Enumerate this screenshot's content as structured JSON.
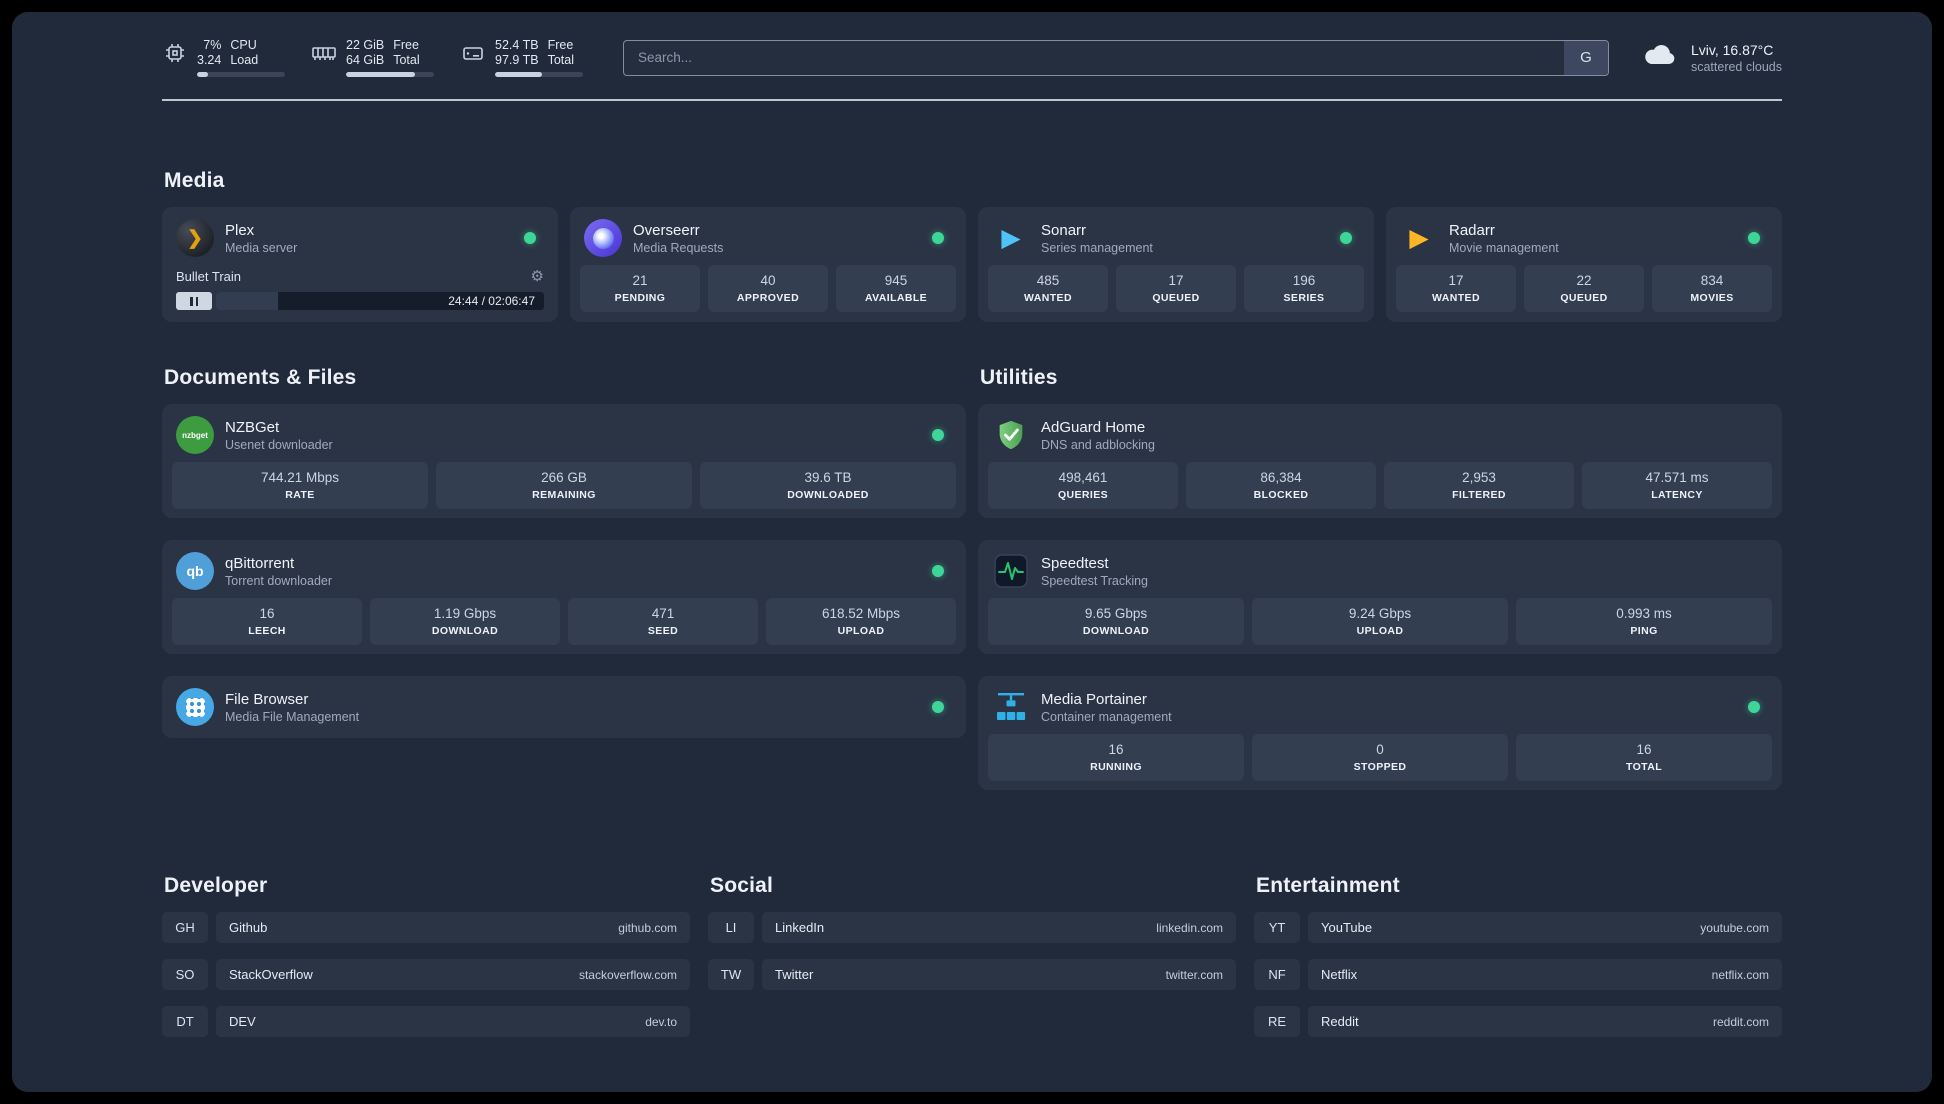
{
  "topbar": {
    "cpu": {
      "value1": "7%",
      "value2": "3.24",
      "label1": "CPU",
      "label2": "Load",
      "progress_pct": 12
    },
    "ram": {
      "value1": "22 GiB",
      "value2": "64 GiB",
      "label1": "Free",
      "label2": "Total",
      "progress_pct": 78
    },
    "disk": {
      "value1": "52.4 TB",
      "value2": "97.9 TB",
      "label1": "Free",
      "label2": "Total",
      "progress_pct": 53
    },
    "search": {
      "placeholder": "Search...",
      "provider": "G"
    },
    "weather": {
      "location": "Lviv, 16.87°C",
      "condition": "scattered clouds"
    }
  },
  "sections": {
    "media": {
      "title": "Media"
    },
    "documents": {
      "title": "Documents & Files"
    },
    "utilities": {
      "title": "Utilities"
    },
    "developer": {
      "title": "Developer"
    },
    "social": {
      "title": "Social"
    },
    "entertainment": {
      "title": "Entertainment"
    }
  },
  "icons": {
    "plex": "❯",
    "sonarr": "▶",
    "radarr": "▶",
    "gear": "⚙",
    "nzbget_text": "nzbget",
    "qb_text": "qb"
  },
  "services": {
    "plex": {
      "name": "Plex",
      "desc": "Media server",
      "player": {
        "title": "Bullet Train",
        "time": "24:44 / 02:06:47",
        "progress_pct": 19
      }
    },
    "overseerr": {
      "name": "Overseerr",
      "desc": "Media Requests",
      "stats": [
        {
          "value": "21",
          "label": "PENDING"
        },
        {
          "value": "40",
          "label": "APPROVED"
        },
        {
          "value": "945",
          "label": "AVAILABLE"
        }
      ]
    },
    "sonarr": {
      "name": "Sonarr",
      "desc": "Series management",
      "stats": [
        {
          "value": "485",
          "label": "WANTED"
        },
        {
          "value": "17",
          "label": "QUEUED"
        },
        {
          "value": "196",
          "label": "SERIES"
        }
      ]
    },
    "radarr": {
      "name": "Radarr",
      "desc": "Movie management",
      "stats": [
        {
          "value": "17",
          "label": "WANTED"
        },
        {
          "value": "22",
          "label": "QUEUED"
        },
        {
          "value": "834",
          "label": "MOVIES"
        }
      ]
    },
    "nzbget": {
      "name": "NZBGet",
      "desc": "Usenet downloader",
      "stats": [
        {
          "value": "744.21 Mbps",
          "label": "RATE"
        },
        {
          "value": "266 GB",
          "label": "REMAINING"
        },
        {
          "value": "39.6 TB",
          "label": "DOWNLOADED"
        }
      ]
    },
    "qbittorrent": {
      "name": "qBittorrent",
      "desc": "Torrent downloader",
      "stats": [
        {
          "value": "16",
          "label": "LEECH"
        },
        {
          "value": "1.19 Gbps",
          "label": "DOWNLOAD"
        },
        {
          "value": "471",
          "label": "SEED"
        },
        {
          "value": "618.52 Mbps",
          "label": "UPLOAD"
        }
      ]
    },
    "filebrowser": {
      "name": "File Browser",
      "desc": "Media File Management"
    },
    "adguard": {
      "name": "AdGuard Home",
      "desc": "DNS and adblocking",
      "stats": [
        {
          "value": "498,461",
          "label": "QUERIES"
        },
        {
          "value": "86,384",
          "label": "BLOCKED"
        },
        {
          "value": "2,953",
          "label": "FILTERED"
        },
        {
          "value": "47.571 ms",
          "label": "LATENCY"
        }
      ]
    },
    "speedtest": {
      "name": "Speedtest",
      "desc": "Speedtest Tracking",
      "stats": [
        {
          "value": "9.65 Gbps",
          "label": "DOWNLOAD"
        },
        {
          "value": "9.24 Gbps",
          "label": "UPLOAD"
        },
        {
          "value": "0.993 ms",
          "label": "PING"
        }
      ]
    },
    "portainer": {
      "name": "Media Portainer",
      "desc": "Container management",
      "stats": [
        {
          "value": "16",
          "label": "RUNNING"
        },
        {
          "value": "0",
          "label": "STOPPED"
        },
        {
          "value": "16",
          "label": "TOTAL"
        }
      ]
    }
  },
  "bookmarks": {
    "developer": [
      {
        "abbr": "GH",
        "name": "Github",
        "url": "github.com"
      },
      {
        "abbr": "SO",
        "name": "StackOverflow",
        "url": "stackoverflow.com"
      },
      {
        "abbr": "DT",
        "name": "DEV",
        "url": "dev.to"
      }
    ],
    "social": [
      {
        "abbr": "LI",
        "name": "LinkedIn",
        "url": "linkedin.com"
      },
      {
        "abbr": "TW",
        "name": "Twitter",
        "url": "twitter.com"
      }
    ],
    "entertainment": [
      {
        "abbr": "YT",
        "name": "YouTube",
        "url": "youtube.com"
      },
      {
        "abbr": "NF",
        "name": "Netflix",
        "url": "netflix.com"
      },
      {
        "abbr": "RE",
        "name": "Reddit",
        "url": "reddit.com"
      }
    ]
  },
  "colors": {
    "status_green": "#3ed598",
    "accent_plex": "#e5a00d"
  }
}
